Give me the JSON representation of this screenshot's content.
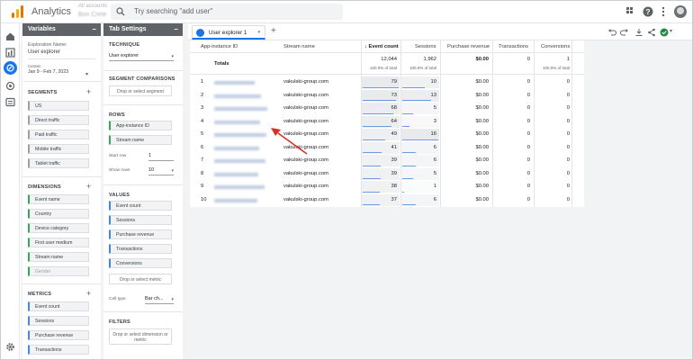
{
  "topbar": {
    "app_title": "Analytics",
    "account_label": "All accounts",
    "account_name": "Bon Crete",
    "search_placeholder": "Try searching \"add user\""
  },
  "variables_panel": {
    "title": "Variables",
    "exploration_name_label": "Exploration Name:",
    "exploration_name": "User explorer",
    "date_custom": "Custom",
    "date_range": "Jan 9 - Feb 7, 2023",
    "segments_label": "SEGMENTS",
    "segments": [
      "US",
      "Direct traffic",
      "Paid traffic",
      "Mobile traffic",
      "Tablet traffic"
    ],
    "dimensions_label": "DIMENSIONS",
    "dimensions": [
      "Event name",
      "Country",
      "Device category",
      "First user medium",
      "Stream name",
      "Gender"
    ],
    "metrics_label": "METRICS",
    "metrics": [
      "Event count",
      "Sessions",
      "Purchase revenue",
      "Transactions"
    ]
  },
  "tab_settings_panel": {
    "title": "Tab Settings",
    "technique_label": "TECHNIQUE",
    "technique_value": "User explorer",
    "segment_comparisons_label": "SEGMENT COMPARISONS",
    "segment_drop": "Drop or select segment",
    "rows_label": "ROWS",
    "rows": [
      "App-instance ID",
      "Stream name"
    ],
    "start_row_label": "Start row",
    "start_row_value": "1",
    "show_rows_label": "Show rows",
    "show_rows_value": "10",
    "values_label": "VALUES",
    "values": [
      "Event count",
      "Sessions",
      "Purchase revenue",
      "Transactions",
      "Conversions"
    ],
    "metric_drop": "Drop or select metric",
    "cell_type_label": "Cell type",
    "cell_type_value": "Bar ch...",
    "filters_label": "FILTERS",
    "filter_drop": "Drop or select dimension or metric"
  },
  "canvas": {
    "tab_label": "User explorer 1"
  },
  "table": {
    "columns": [
      "App-instance ID",
      "Stream name",
      "↓ Event count",
      "Sessions",
      "Purchase revenue",
      "Transactions",
      "Conversions"
    ],
    "totals_label": "Totals",
    "totals": {
      "event_count": "12,044",
      "event_count_sub": "100.0% of total",
      "sessions": "1,962",
      "sessions_sub": "100.0% of total",
      "purchase_revenue": "$0.00",
      "transactions": "0",
      "conversions": "1",
      "conversions_sub": "100.0% of total"
    },
    "rows": [
      {
        "n": "1",
        "stream": "vakulski-group.com",
        "events": "79",
        "sessions": "10",
        "revenue": "$0.00",
        "transactions": "0",
        "conversions": "0",
        "event_pct": 1.0,
        "session_pct": 0.63
      },
      {
        "n": "2",
        "stream": "vakulski-group.com",
        "events": "73",
        "sessions": "13",
        "revenue": "$0.00",
        "transactions": "0",
        "conversions": "0",
        "event_pct": 0.92,
        "session_pct": 0.81
      },
      {
        "n": "3",
        "stream": "vakulski-group.com",
        "events": "68",
        "sessions": "5",
        "revenue": "$0.00",
        "transactions": "0",
        "conversions": "0",
        "event_pct": 0.86,
        "session_pct": 0.31
      },
      {
        "n": "4",
        "stream": "vakulski-group.com",
        "events": "64",
        "sessions": "3",
        "revenue": "$0.00",
        "transactions": "0",
        "conversions": "0",
        "event_pct": 0.81,
        "session_pct": 0.19
      },
      {
        "n": "5",
        "stream": "vakulski-group.com",
        "events": "49",
        "sessions": "16",
        "revenue": "$0.00",
        "transactions": "0",
        "conversions": "0",
        "event_pct": 0.62,
        "session_pct": 1.0
      },
      {
        "n": "6",
        "stream": "vakulski-group.com",
        "events": "41",
        "sessions": "6",
        "revenue": "$0.00",
        "transactions": "0",
        "conversions": "0",
        "event_pct": 0.52,
        "session_pct": 0.38
      },
      {
        "n": "7",
        "stream": "vakulski-group.com",
        "events": "39",
        "sessions": "6",
        "revenue": "$0.00",
        "transactions": "0",
        "conversions": "0",
        "event_pct": 0.49,
        "session_pct": 0.38
      },
      {
        "n": "8",
        "stream": "vakulski-group.com",
        "events": "39",
        "sessions": "5",
        "revenue": "$0.00",
        "transactions": "0",
        "conversions": "0",
        "event_pct": 0.49,
        "session_pct": 0.31
      },
      {
        "n": "9",
        "stream": "vakulski-group.com",
        "events": "38",
        "sessions": "1",
        "revenue": "$0.00",
        "transactions": "0",
        "conversions": "0",
        "event_pct": 0.48,
        "session_pct": 0.06
      },
      {
        "n": "10",
        "stream": "vakulski-group.com",
        "events": "37",
        "sessions": "6",
        "revenue": "$0.00",
        "transactions": "0",
        "conversions": "0",
        "event_pct": 0.47,
        "session_pct": 0.38
      }
    ]
  },
  "colors": {
    "accent": "#1a73e8",
    "arrow": "#d93025",
    "heat": "#e8eaed",
    "bar": "#6a9be4",
    "dimension_chip": "#34a853",
    "metric_chip": "#4285f4"
  }
}
